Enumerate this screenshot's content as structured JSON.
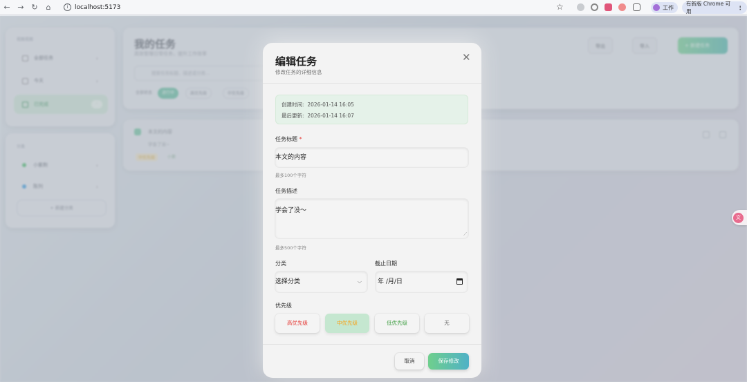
{
  "browser": {
    "url": "localhost:5173",
    "profile_label": "工作",
    "update_label": "有新版 Chrome 可用"
  },
  "background": {
    "sidebar_section1": "视图视图",
    "sidebar_items": [
      {
        "label": "全部任务",
        "icon": "grid-icon"
      },
      {
        "label": "今天",
        "icon": "calendar-icon"
      },
      {
        "label": "已完成",
        "icon": "check-icon"
      }
    ],
    "sidebar_section2": "分类",
    "categories": [
      {
        "label": "小紫荆",
        "color": "#5cc27a"
      },
      {
        "label": "陈列",
        "color": "#4aa3e0"
      }
    ],
    "add_category": "+ 新建分类",
    "page_title": "我的任务",
    "page_subtitle": "高效管理日常任务，提升工作效率",
    "search_placeholder": "搜索任务标题、描述或分类...",
    "filters": [
      "全部状态",
      "进行中",
      "高优先级",
      "中优先级"
    ],
    "buttons": [
      "导出",
      "导入",
      "+ 新建任务"
    ],
    "task_title": "本文的内容",
    "task_desc": "学会了没~",
    "task_tags": [
      "中优先级",
      "小紫"
    ]
  },
  "modal": {
    "title": "编辑任务",
    "subtitle": "修改任务的详细信息",
    "created_label": "创建时间:",
    "created_value": "2026-01-14 16:05",
    "updated_label": "最后更新:",
    "updated_value": "2026-01-14 16:07",
    "title_label": "任务标题",
    "required_mark": "*",
    "title_value": "本文的内容",
    "title_hint": "最多100个字符",
    "desc_label": "任务描述",
    "desc_value": "学会了没～",
    "desc_hint": "最多500个字符",
    "category_label": "分类",
    "category_value": "选择分类",
    "due_label": "截止日期",
    "due_placeholder": "年 /月/日",
    "priority_label": "优先级",
    "priorities": [
      {
        "label": "高优先级",
        "color": "#e53935"
      },
      {
        "label": "中优先级",
        "color": "#f5a623",
        "selected": true
      },
      {
        "label": "低优先级",
        "color": "#43a047"
      },
      {
        "label": "无",
        "color": "#666666"
      }
    ],
    "cancel_label": "取消",
    "save_label": "保存修改",
    "accent_gradient": [
      "#6fcf8d",
      "#4fb1c6"
    ]
  }
}
